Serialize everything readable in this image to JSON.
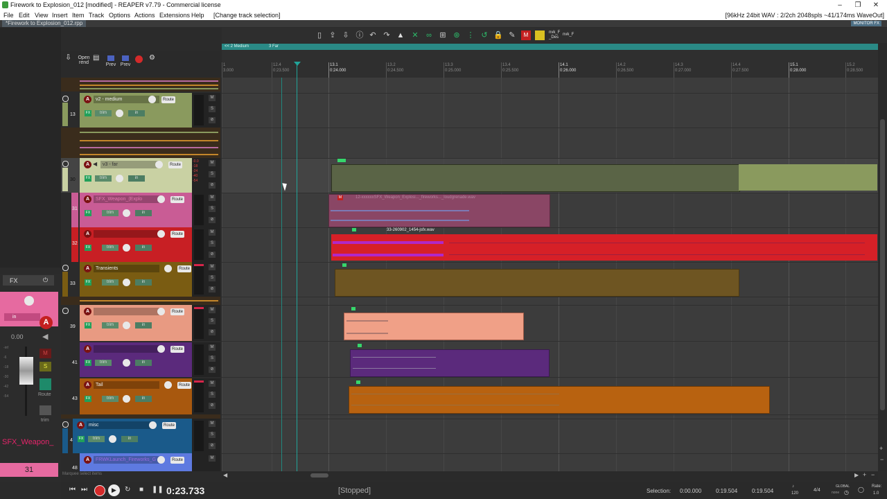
{
  "window": {
    "title": "Firework to Explosion_012 [modified] - REAPER v7.79 - Commercial license",
    "minimize": "–",
    "maximize": "❐",
    "close": "✕"
  },
  "menu": {
    "items": [
      "File",
      "Edit",
      "View",
      "Insert",
      "Item",
      "Track",
      "Options",
      "Actions",
      "Extensions",
      "Help"
    ],
    "action": "[Change track selection]",
    "status": "[96kHz 24bit WAV : 2/2ch 2048spls ~41/174ms WaveOut]"
  },
  "project_tab": "*Firework to Explosion_012.rpp",
  "monitor_fx": "MONITOR FX",
  "toolbar": {
    "nvk1": "nvk_F",
    "nvk1_sub": "_Des",
    "nvk2": "nvk_F",
    "m_label": "M"
  },
  "left_toolbar": {
    "open_render": "Open rend",
    "prev1": "Prev",
    "prev2": "Prev"
  },
  "regions": [
    {
      "name": "<< 2 Medium"
    },
    {
      "name": "3 Far"
    }
  ],
  "ruler": [
    {
      "bar": "1",
      "time": "3.000"
    },
    {
      "bar": "12.4",
      "time": "0:23.500"
    },
    {
      "bar": "13.1",
      "time": "0:24.000"
    },
    {
      "bar": "13.2",
      "time": "0:24.500"
    },
    {
      "bar": "13.3",
      "time": "0:25.000"
    },
    {
      "bar": "13.4",
      "time": "0:25.500"
    },
    {
      "bar": "14.1",
      "time": "0:26.000"
    },
    {
      "bar": "14.2",
      "time": "0:26.500"
    },
    {
      "bar": "14.3",
      "time": "0:27.000"
    },
    {
      "bar": "14.4",
      "time": "0:27.500"
    },
    {
      "bar": "15.1",
      "time": "0:28.000"
    },
    {
      "bar": "15.2",
      "time": "0:28.500"
    }
  ],
  "tracks": [
    {
      "num": "13",
      "name": "v2 - medium",
      "color": "#8a9a5e"
    },
    {
      "num": "30",
      "name": "v3 - far",
      "color": "#c9d1a3",
      "meter": [
        "-0.0",
        "-18",
        "-24",
        "-40",
        "-54"
      ]
    },
    {
      "num": "31",
      "name": "SFX_Weapon_(Explo",
      "color": "#c95c95"
    },
    {
      "num": "32",
      "name": "",
      "color": "#c81f24"
    },
    {
      "num": "33",
      "name": "Transients",
      "color": "#7a5c12"
    },
    {
      "num": "39",
      "name": "",
      "color": "#e89a82"
    },
    {
      "num": "41",
      "name": "",
      "color": "#5b2a7c"
    },
    {
      "num": "43",
      "name": "Tail",
      "color": "#a8580e"
    },
    {
      "num": "47",
      "name": "misc",
      "color": "#1a5a8a"
    },
    {
      "num": "48",
      "name": "FRWKLaunch_Fireworks_G",
      "color": "#5e7ae0"
    }
  ],
  "track_labels": {
    "fx": "FX",
    "trim": "trim",
    "in": "in",
    "route": "Route",
    "mute": "M",
    "solo": "S",
    "arm": "A"
  },
  "items": [
    {
      "name": "12-xxxxxxSFX_Weapon_Explosi..._fireworks..._loudgrenade.wav",
      "color": "#9c4b72"
    },
    {
      "name": "33-260902_1454-jsfx.wav",
      "color": "#d62027"
    }
  ],
  "mixer": {
    "fx": "FX",
    "in": "in",
    "volume": "0.00",
    "route": "Route",
    "trim": "trim",
    "track_name": "SFX_Weapon_",
    "track_num": "31",
    "scale": [
      "-inf",
      "-6",
      "-18",
      "-30",
      "-42",
      "-54"
    ],
    "arm": "A",
    "mute": "M",
    "solo": "S"
  },
  "status_hint": "Marquee select items",
  "transport": {
    "time": "0:23.733",
    "state": "[Stopped]",
    "selection_label": "Selection:",
    "sel_start": "0:00.000",
    "sel_end": "0:19.504",
    "sel_len": "0:19.504",
    "bpm": "120",
    "sig": "4/4",
    "global": "GLOBAL",
    "global_sub": "none",
    "rate_label": "Rate:",
    "rate": "1.0"
  },
  "colors": {
    "accent": "#21a59a",
    "region": "#2a8a86",
    "record": "#d42a2a"
  }
}
